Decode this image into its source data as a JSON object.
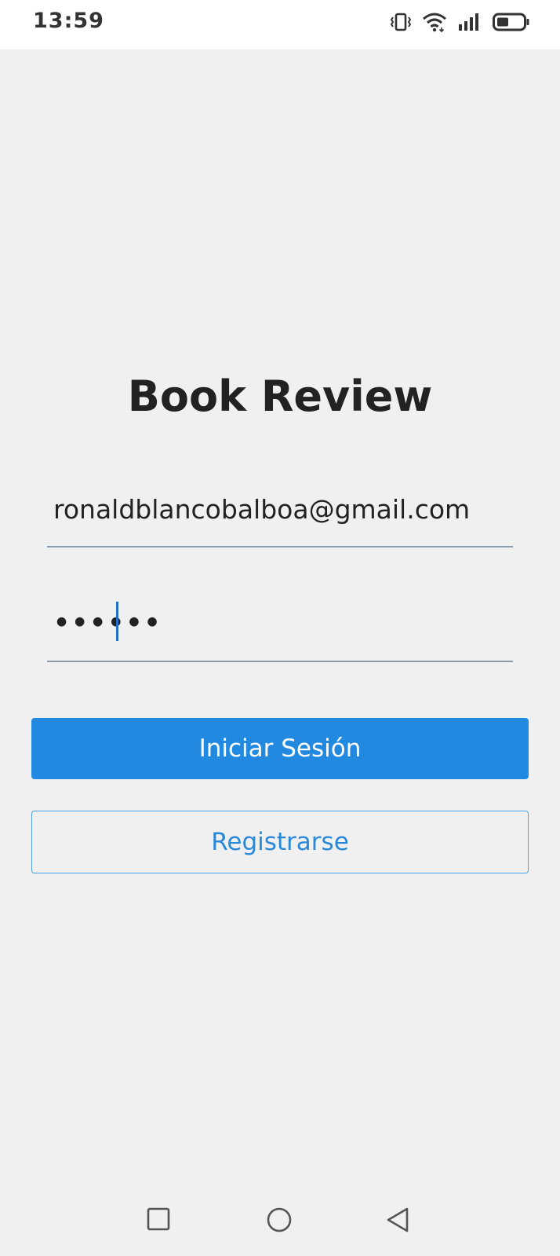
{
  "status_bar": {
    "time": "13:59",
    "icons": [
      "vibrate-icon",
      "wifi-icon",
      "signal-icon",
      "battery-icon"
    ]
  },
  "app": {
    "title": "Book Review"
  },
  "login_form": {
    "email_value": "ronaldblancobalboa@gmail.com",
    "password_value": "••••••",
    "login_button_label": "Iniciar Sesión",
    "register_button_label": "Registrarse"
  },
  "nav_bar": {
    "buttons": [
      "recents-icon",
      "home-icon",
      "back-icon"
    ]
  },
  "colors": {
    "primary": "#2189e0",
    "background": "#f0f0f0",
    "underline": "#8a9bab",
    "cursor": "#1f6fc7"
  }
}
